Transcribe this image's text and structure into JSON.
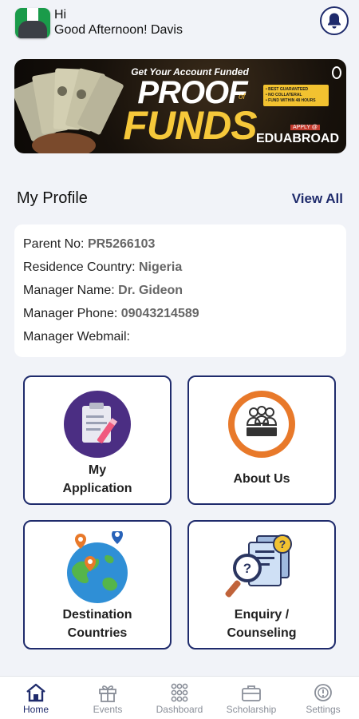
{
  "header": {
    "greeting": "Hi",
    "message": "Good Afternoon! Davis"
  },
  "banner": {
    "tagline": "Get Your Account Funded",
    "headline_1": "PROOF",
    "headline_of": "of",
    "headline_2": "FUNDS",
    "bullets": [
      "• BEST GUARANTEED",
      "• NO COLLATERAL",
      "• FUND WITHIN 48 HOURS"
    ],
    "apply": "APPLY @",
    "brand": "EDUABROAD"
  },
  "profile": {
    "title": "My Profile",
    "view_all": "View All",
    "rows": [
      {
        "label": "Parent No: ",
        "value": "PR5266103"
      },
      {
        "label": "Residence Country: ",
        "value": "Nigeria"
      },
      {
        "label": "Manager Name: ",
        "value": "Dr. Gideon"
      },
      {
        "label": "Manager Phone: ",
        "value": "09043214589"
      },
      {
        "label": "Manager Webmail: ",
        "value": ""
      }
    ]
  },
  "cards": {
    "my_application": {
      "line1": "My",
      "line2": "Application"
    },
    "about_us": {
      "label": "About Us",
      "badge": "ABOUT US"
    },
    "destination": {
      "line1": "Destination",
      "line2": "Countries"
    },
    "enquiry": {
      "line1": "Enquiry /",
      "line2": "Counseling"
    }
  },
  "nav": {
    "items": [
      {
        "label": "Home",
        "icon": "home-icon"
      },
      {
        "label": "Events",
        "icon": "gift-icon"
      },
      {
        "label": "Dashboard",
        "icon": "grid-icon"
      },
      {
        "label": "Scholarship",
        "icon": "briefcase-icon"
      },
      {
        "label": "Settings",
        "icon": "settings-icon"
      }
    ]
  },
  "colors": {
    "primary": "#1f2b6c",
    "background": "#f1f3f8",
    "accent_orange": "#e8792a",
    "accent_purple": "#5b3a8f"
  }
}
